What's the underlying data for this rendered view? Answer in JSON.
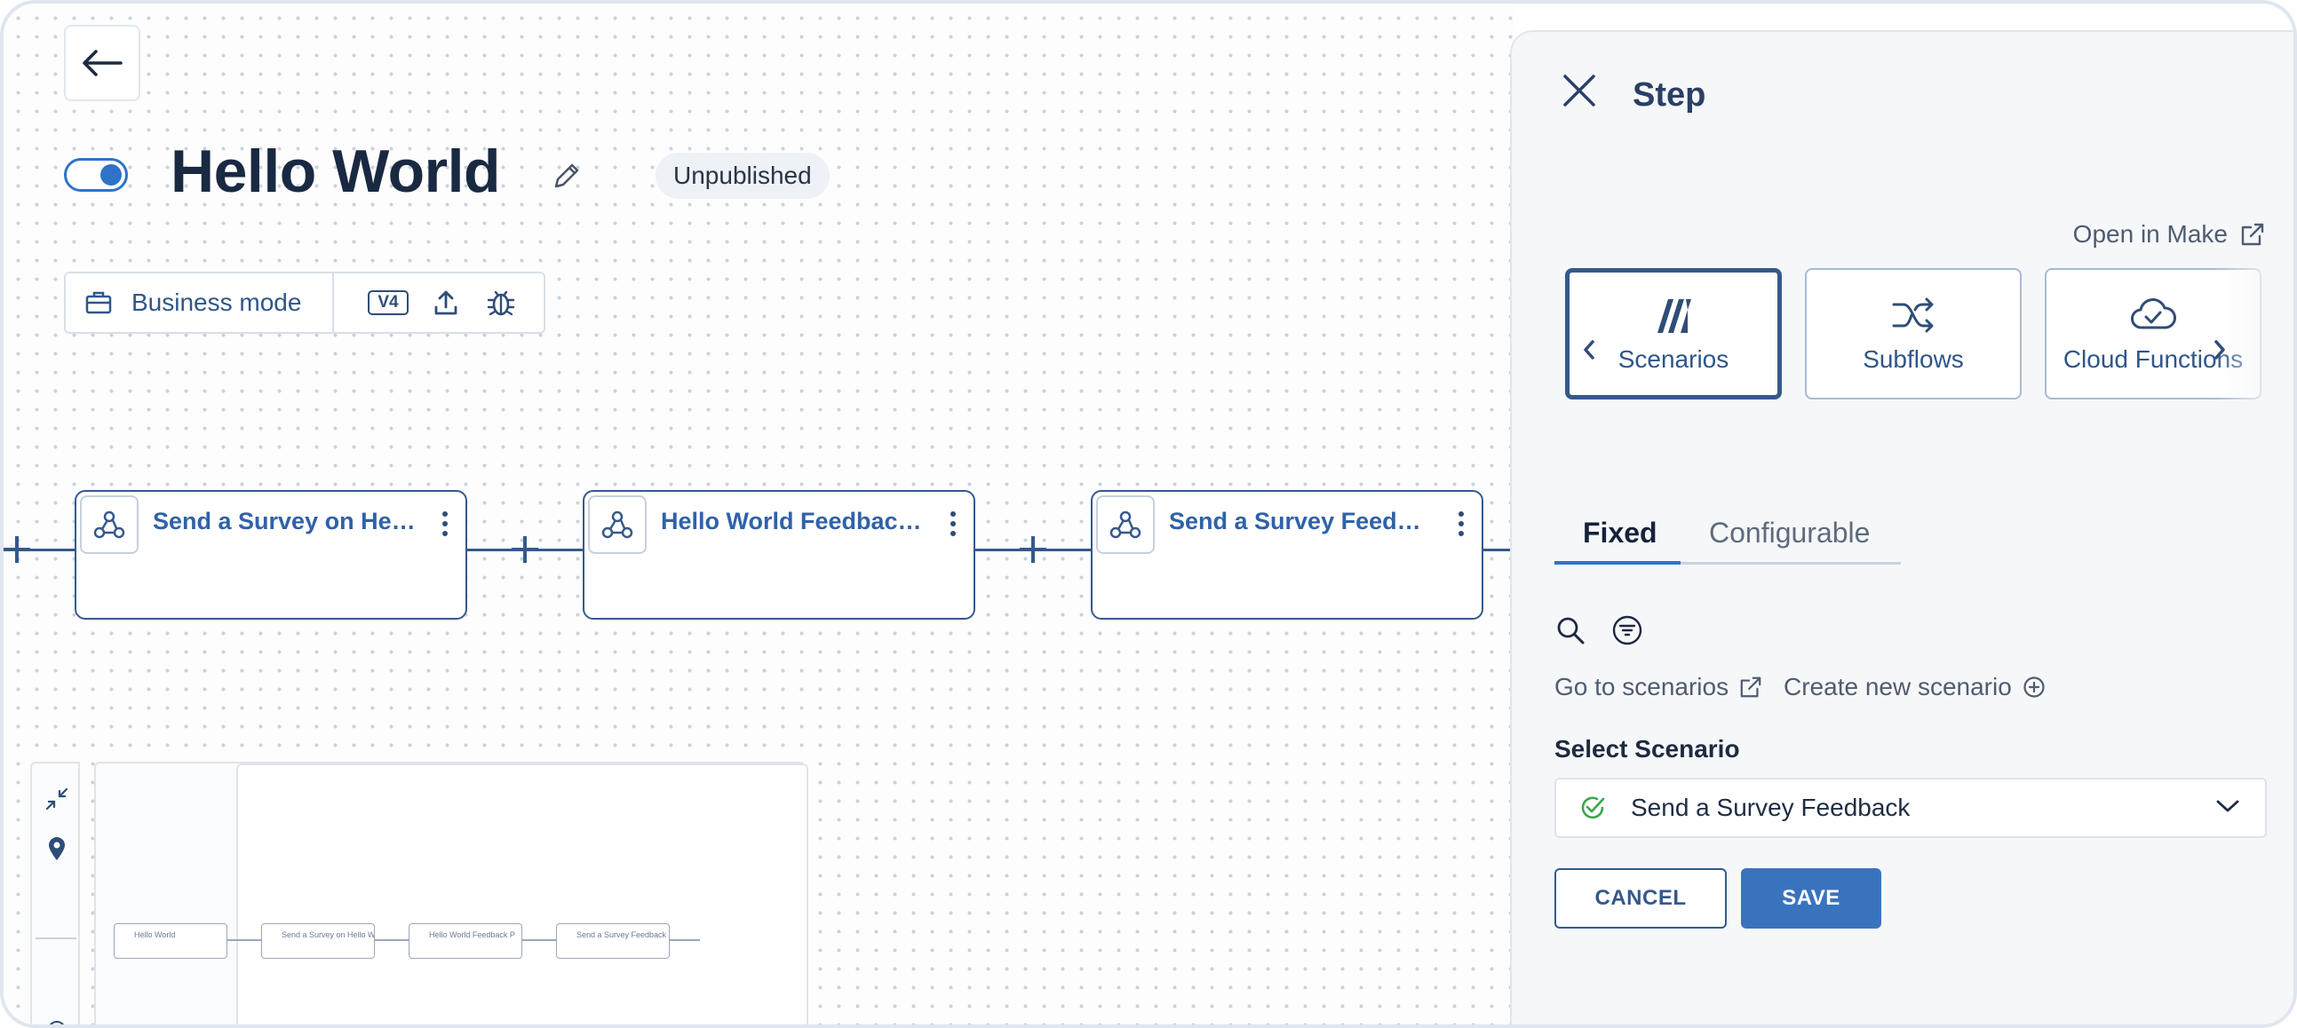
{
  "header": {
    "title": "Hello World",
    "status_badge": "Unpublished",
    "published_toggle": "on"
  },
  "toolbar": {
    "mode_label": "Business mode",
    "version_label": "V4"
  },
  "flow": {
    "nodes": [
      {
        "title": "Send a Survey on Hell..."
      },
      {
        "title": "Hello World Feedback..."
      },
      {
        "title": "Send a Survey Feedback"
      }
    ]
  },
  "minimap": {
    "nodes": [
      {
        "title": "Hello World"
      },
      {
        "title": "Send a Survey on Hello W"
      },
      {
        "title": "Hello World Feedback P"
      },
      {
        "title": "Send a Survey Feedback"
      }
    ]
  },
  "panel": {
    "title": "Step",
    "open_in_make": "Open in Make",
    "cards": [
      {
        "label": "Scenarios",
        "icon": "scenarios-icon",
        "active": true
      },
      {
        "label": "Subflows",
        "icon": "shuffle-icon",
        "active": false
      },
      {
        "label": "Cloud Functions",
        "icon": "cloud-check-icon",
        "active": false
      }
    ],
    "tabs": [
      {
        "label": "Fixed",
        "active": true
      },
      {
        "label": "Configurable",
        "active": false
      }
    ],
    "go_to_scenarios": "Go to scenarios",
    "create_new_scenario": "Create new scenario",
    "select_label": "Select Scenario",
    "select_value": "Send a Survey Feedback",
    "cancel_label": "CANCEL",
    "save_label": "SAVE"
  },
  "colors": {
    "accent": "#2f73c9",
    "node_border": "#35598c",
    "node_title": "#2f62a8",
    "success": "#3aa64a",
    "save_button": "#3a73bd"
  }
}
